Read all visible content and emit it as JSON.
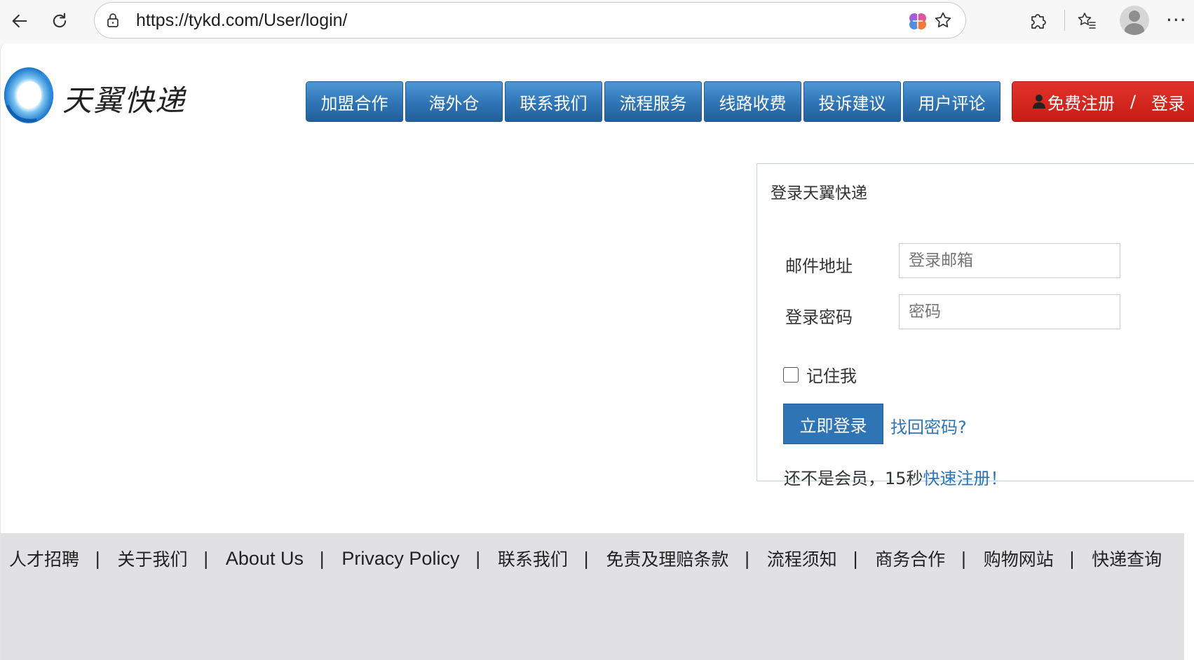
{
  "browser": {
    "url": "https://tykd.com/User/login/"
  },
  "site": {
    "brand_name": "天翼快递"
  },
  "nav": {
    "items": [
      {
        "label": "加盟合作"
      },
      {
        "label": "海外仓"
      },
      {
        "label": "联系我们"
      },
      {
        "label": "流程服务"
      },
      {
        "label": "线路收费"
      },
      {
        "label": "投诉建议"
      },
      {
        "label": "用户评论"
      }
    ],
    "register_label": "免费注册",
    "separator": "/",
    "login_label": "登录"
  },
  "login": {
    "title": "登录天翼快递",
    "email_label": "邮件地址",
    "email_placeholder": "登录邮箱",
    "password_label": "登录密码",
    "password_placeholder": "密码",
    "remember_label": "记住我",
    "submit_label": "立即登录",
    "forgot_label": "找回密码?",
    "not_member_text": "还不是会员，15秒",
    "quick_register_label": "快速注册！"
  },
  "footer": {
    "links": [
      {
        "label": "人才招聘"
      },
      {
        "label": "关于我们"
      },
      {
        "label": "About Us"
      },
      {
        "label": "Privacy Policy"
      },
      {
        "label": "联系我们"
      },
      {
        "label": "免责及理赔条款"
      },
      {
        "label": "流程须知"
      },
      {
        "label": "商务合作"
      },
      {
        "label": "购物网站"
      },
      {
        "label": "快递查询"
      }
    ],
    "separator": "|"
  },
  "colors": {
    "nav_blue": "#2f74b5",
    "register_red": "#d4241c",
    "link_blue": "#2f74b5",
    "footer_bg": "#e1e1e3"
  }
}
